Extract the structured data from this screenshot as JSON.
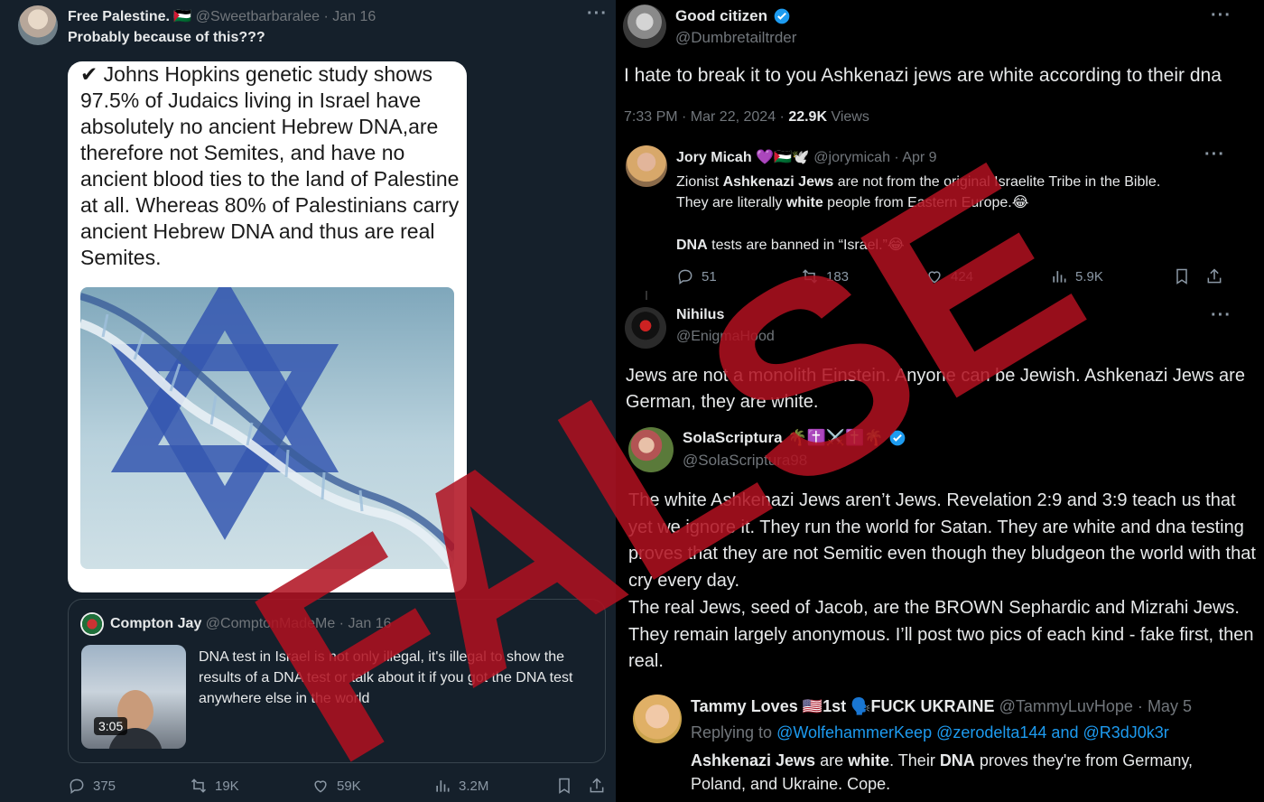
{
  "left_post": {
    "author_name": "Free Palestine.",
    "author_flag": "🇵🇸",
    "handle": "@Sweetbarbaralee",
    "date": "Jan 16",
    "text": "Probably because of this???",
    "image_text": "✔ Johns Hopkins genetic study shows 97.5% of Judaics living in Israel have absolutely no ancient Hebrew DNA,are therefore not Semites, and have no ancient blood ties to the land of Palestine at all. Whereas 80% of Palestinians carry ancient Hebrew DNA and thus are real Semites.",
    "quote": {
      "author_name": "Compton Jay",
      "handle": "@ComptonMadeMe",
      "date": "Jan 16",
      "text": "DNA test in Israel is not only illegal, it's illegal to show the results of a DNA test or talk about it if you got the DNA test anywhere else in the world",
      "video_duration": "3:05"
    },
    "stats": {
      "replies": "375",
      "reposts": "19K",
      "likes": "59K",
      "views": "3.2M"
    }
  },
  "right_post": {
    "author_name": "Good citizen",
    "handle": "@Dumbretailtrder",
    "text": "I hate to break it to you Ashkenazi  jews are white according to their dna",
    "timestamp": "7:33 PM · Mar 22, 2024 ·",
    "views_count": "22.9K",
    "views_label": "Views"
  },
  "reply_jory": {
    "author_name": "Jory Micah",
    "author_emoji": "💜🇵🇸🕊️",
    "handle": "@jorymicah",
    "date": "Apr 9",
    "line1_a": "Zionist ",
    "line1_b": "Ashkenazi Jews",
    "line1_c": " are not from the original Israelite Tribe in the Bible.",
    "line2_a": "They are literally ",
    "line2_b": "white",
    "line2_c": " people from Eastern Europe.😂",
    "line3_a": "DNA",
    "line3_b": " tests are banned in “Israel.”😂",
    "stats": {
      "replies": "51",
      "reposts": "183",
      "likes": "424",
      "views": "5.9K"
    }
  },
  "reply_nihilus": {
    "author_name": "Nihilus",
    "handle": "@EnigmaHood",
    "text": "Jews are not a monolith Einstein. Anyone can be Jewish. Ashkenazi Jews are German, they are white."
  },
  "reply_sola": {
    "author_name": "SolaScriptura",
    "author_emoji": "🌴✝️⚔️✝️🌴",
    "handle": "@SolaScriptura98",
    "para1": "The white Ashkenazi Jews aren’t Jews. Revelation 2:9 and 3:9 teach us that yet we ignore it. They run the world for Satan. They are white and dna testing proves that they are not Semitic even though they bludgeon the world with that cry every day.",
    "para2": "The real Jews, seed of Jacob, are the BROWN Sephardic and Mizrahi Jews. They remain largely anonymous. I’ll post two pics of each kind - fake first, then real."
  },
  "reply_tammy": {
    "author_name": "Tammy Loves 🇺🇸1st 🗣️FUCK UKRAINE",
    "handle": "@TammyLuvHope",
    "date": "May 5",
    "replying_label": "Replying to ",
    "replying_to": "@WolfehammerKeep @zerodelta144 and @R3dJ0k3r",
    "t1": "Ashkenazi Jews",
    "t2": " are ",
    "t3": "white",
    "t4": ". Their ",
    "t5": "DNA",
    "t6": " proves they're from Germany,",
    "t7": "Poland, and Ukraine. Cope."
  },
  "overlay": {
    "stamp_text": "FALSE",
    "color": "#b0101f"
  },
  "colors": {
    "left_bg": "#15202b",
    "right_bg": "#000000",
    "link": "#1d9bf0",
    "verified": "#1d9bf0"
  }
}
